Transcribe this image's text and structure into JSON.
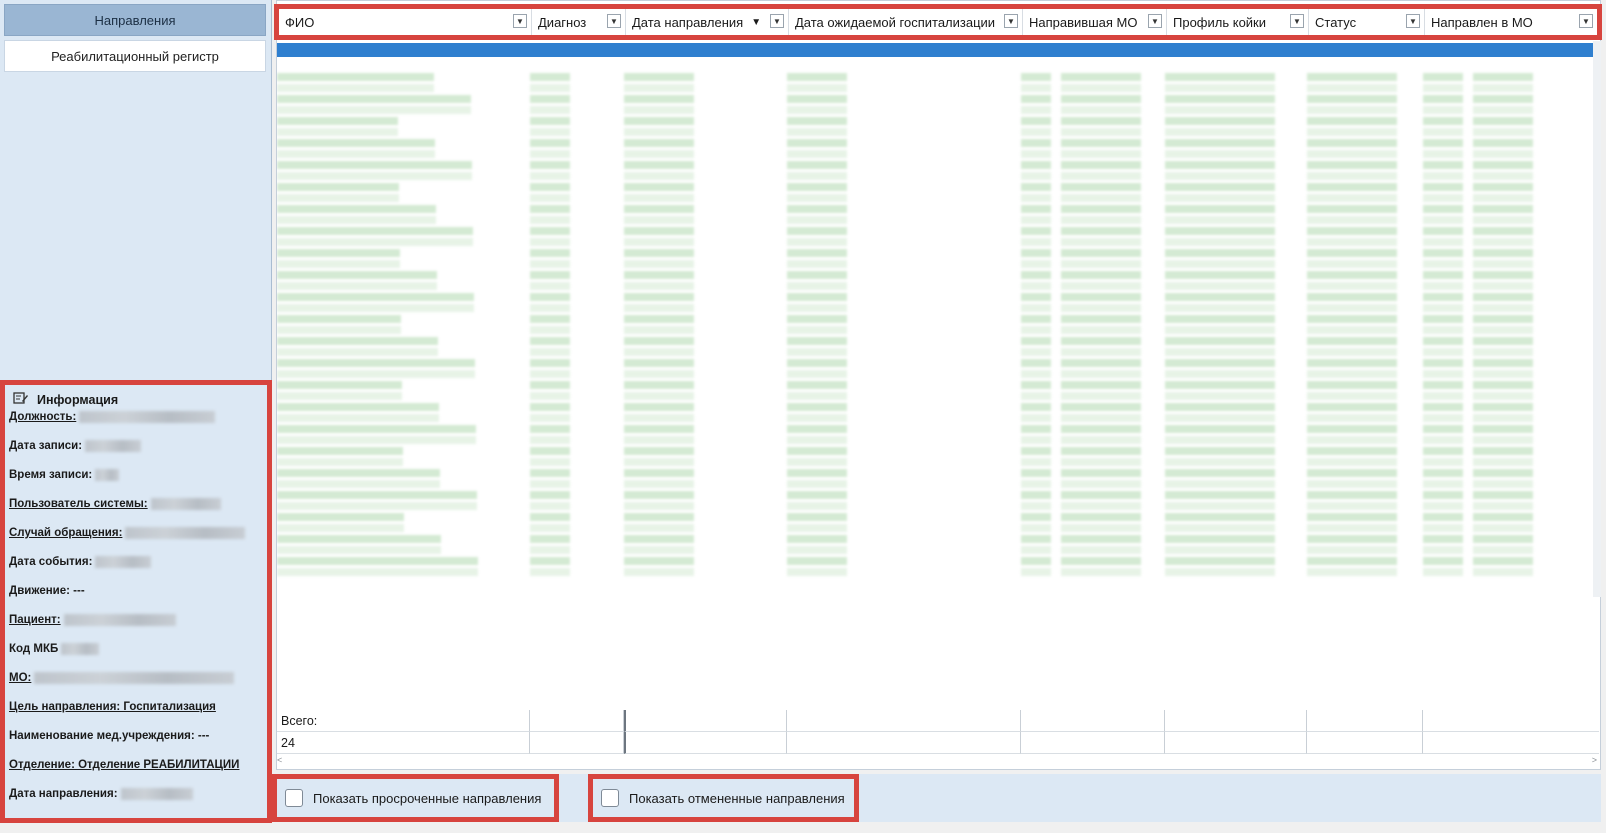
{
  "sidebar": {
    "nav": [
      "Направления",
      "Реабилитационный регистр"
    ],
    "info": {
      "title": "Информация",
      "rows": [
        {
          "label": "Должность:",
          "value": ""
        },
        {
          "label": "Дата записи:",
          "value": ""
        },
        {
          "label": "Время записи:",
          "value": ""
        },
        {
          "label": "Пользователь системы:",
          "value": ""
        },
        {
          "label": "Случай обращения:",
          "value": ""
        },
        {
          "label": "Дата события:",
          "value": ""
        },
        {
          "label": "Движение: ---",
          "value": ""
        },
        {
          "label": "Пациент:",
          "value": ""
        },
        {
          "label": "Код МКБ",
          "value": ""
        },
        {
          "label": "МО:",
          "value": ""
        },
        {
          "label": "Цель направления: Госпитализация",
          "value": ""
        },
        {
          "label": "Наименование мед.учреждения: ---",
          "value": ""
        },
        {
          "label": "Отделение: Отделение РЕАБИЛИТАЦИИ",
          "value": ""
        },
        {
          "label": "Дата направления:",
          "value": ""
        }
      ]
    }
  },
  "grid": {
    "columns": [
      "ФИО",
      "Диагноз",
      "Дата направления",
      "Дата ожидаемой госпитализации",
      "Направившая МО",
      "Профиль койки",
      "Статус",
      "Направлен в МО"
    ],
    "footer_label": "Всего:",
    "footer_count": "24"
  },
  "options": {
    "overdue": "Показать просроченные направления",
    "cancelled": "Показать отмененные направления"
  },
  "colors": {
    "accent": "#d7443e",
    "selected_row": "#2f7fcf",
    "panel": "#dce8f4"
  }
}
